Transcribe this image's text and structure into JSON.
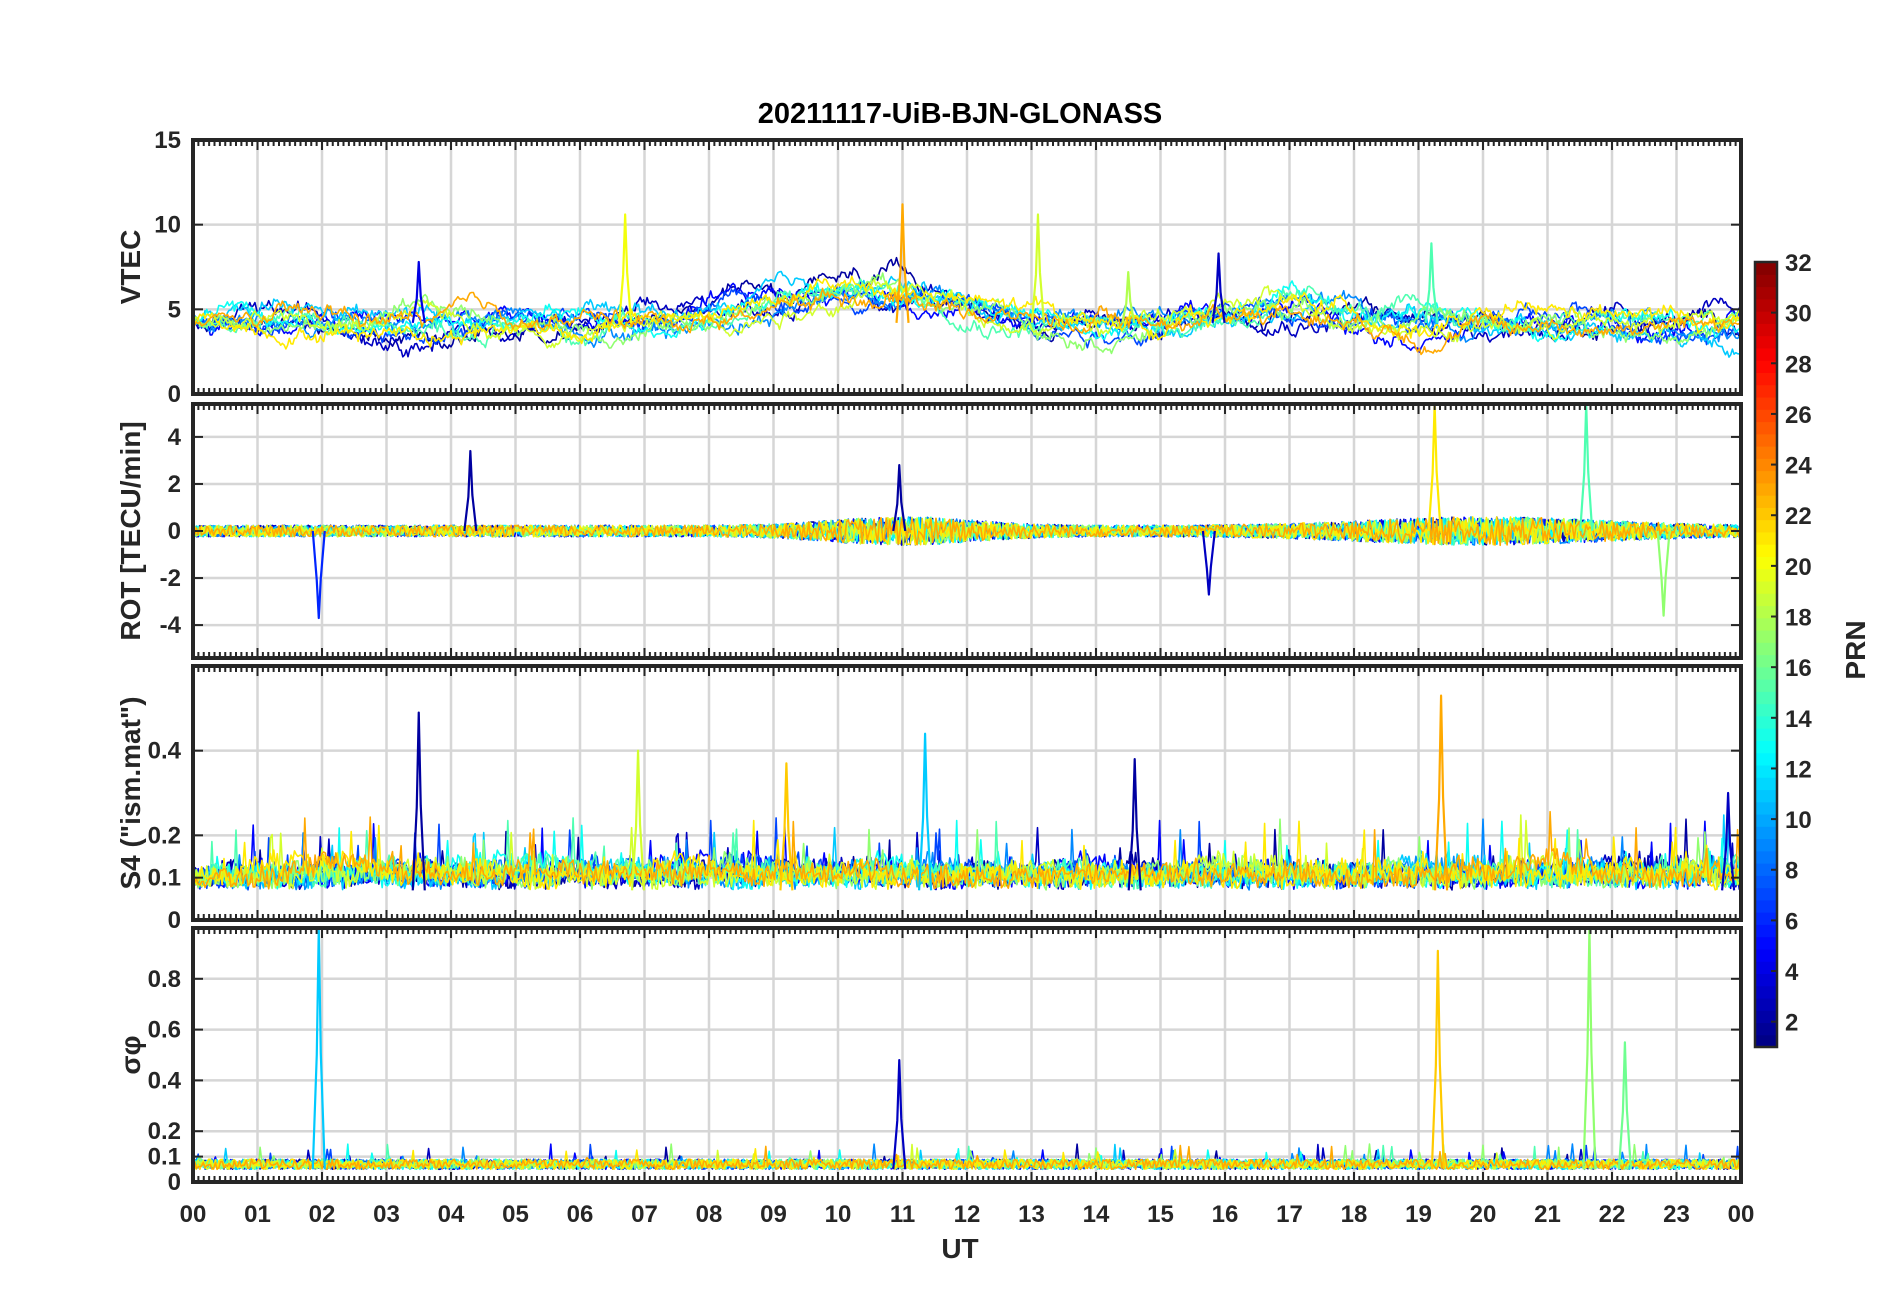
{
  "chart_data": {
    "type": "line",
    "title": "20211117-UiB-BJN-GLONASS",
    "xlabel": "UT",
    "x_tick_labels": [
      "00",
      "01",
      "02",
      "03",
      "04",
      "05",
      "06",
      "07",
      "08",
      "09",
      "10",
      "11",
      "12",
      "13",
      "14",
      "15",
      "16",
      "17",
      "18",
      "19",
      "20",
      "21",
      "22",
      "23",
      "00"
    ],
    "xlim_hours": [
      0,
      24
    ],
    "grid": true,
    "colorbar": {
      "label": "PRN",
      "range": [
        1,
        32
      ],
      "ticks": [
        "2",
        "4",
        "6",
        "8",
        "10",
        "12",
        "14",
        "16",
        "18",
        "20",
        "22",
        "24",
        "26",
        "28",
        "30",
        "32"
      ],
      "colormap": "jet"
    },
    "panels": [
      {
        "id": "vtec",
        "ylabel": "VTEC",
        "ylim": [
          0,
          15
        ],
        "yticks": [
          "0",
          "5",
          "10",
          "15"
        ],
        "ytick_values": [
          0,
          5,
          10,
          15
        ],
        "grid_values": [
          5,
          10
        ],
        "baseline": 4.2,
        "noise": 1.0,
        "features": [
          {
            "hour": 11.0,
            "value": 11.2,
            "prn": 23
          },
          {
            "hour": 6.7,
            "value": 10.6,
            "prn": 20
          },
          {
            "hour": 13.1,
            "value": 10.6,
            "prn": 19
          },
          {
            "hour": 19.2,
            "value": 8.9,
            "prn": 15
          },
          {
            "hour": 15.9,
            "value": 8.3,
            "prn": 3
          },
          {
            "hour": 3.5,
            "value": 7.8,
            "prn": 4
          },
          {
            "hour": 14.5,
            "value": 7.2,
            "prn": 18
          }
        ]
      },
      {
        "id": "rot",
        "ylabel": "ROT [TECU/min]",
        "ylim": [
          -5.4,
          5.4
        ],
        "yticks": [
          "-4",
          "-2",
          "0",
          "2",
          "4"
        ],
        "ytick_values": [
          -4,
          -2,
          0,
          2,
          4
        ],
        "grid_values": [
          -4,
          -2,
          0,
          2,
          4
        ],
        "baseline": 0,
        "noise": 0.35,
        "features": [
          {
            "hour": 19.25,
            "value": 5.4,
            "prn": 21
          },
          {
            "hour": 21.6,
            "value": 5.4,
            "prn": 15
          },
          {
            "hour": 4.3,
            "value": 3.4,
            "prn": 2
          },
          {
            "hour": 1.95,
            "value": -3.7,
            "prn": 6
          },
          {
            "hour": 15.75,
            "value": -2.7,
            "prn": 3
          },
          {
            "hour": 22.8,
            "value": -3.6,
            "prn": 17
          },
          {
            "hour": 10.95,
            "value": 2.8,
            "prn": 2
          }
        ]
      },
      {
        "id": "s4",
        "ylabel": "S4 (\"ism.mat\")",
        "ylim": [
          0,
          0.6
        ],
        "yticks": [
          "0",
          "0.1",
          "0.2",
          "0.4"
        ],
        "ytick_values": [
          0,
          0.1,
          0.2,
          0.4
        ],
        "grid_values": [
          0.1,
          0.2,
          0.4
        ],
        "baseline": 0.07,
        "noise": 0.05,
        "features": [
          {
            "hour": 19.35,
            "value": 0.53,
            "prn": 23
          },
          {
            "hour": 3.5,
            "value": 0.49,
            "prn": 2
          },
          {
            "hour": 11.35,
            "value": 0.44,
            "prn": 11
          },
          {
            "hour": 6.9,
            "value": 0.4,
            "prn": 19
          },
          {
            "hour": 14.6,
            "value": 0.38,
            "prn": 2
          },
          {
            "hour": 9.2,
            "value": 0.37,
            "prn": 22
          },
          {
            "hour": 23.8,
            "value": 0.3,
            "prn": 3
          }
        ]
      },
      {
        "id": "sigma_phi",
        "ylabel": "σφ",
        "ylim": [
          0,
          1
        ],
        "yticks": [
          "0",
          "0.1",
          "0.2",
          "0.4",
          "0.6",
          "0.8"
        ],
        "ytick_values": [
          0,
          0.1,
          0.2,
          0.4,
          0.6,
          0.8
        ],
        "grid_values": [
          0.1,
          0.2,
          0.4,
          0.6,
          0.8
        ],
        "baseline": 0.05,
        "noise": 0.04,
        "features": [
          {
            "hour": 1.95,
            "value": 1.0,
            "prn": 11
          },
          {
            "hour": 21.65,
            "value": 1.0,
            "prn": 17
          },
          {
            "hour": 19.3,
            "value": 0.91,
            "prn": 22
          },
          {
            "hour": 22.2,
            "value": 0.55,
            "prn": 16
          },
          {
            "hour": 10.95,
            "value": 0.48,
            "prn": 3
          }
        ]
      }
    ],
    "series_prns": [
      2,
      3,
      5,
      7,
      9,
      11,
      13,
      15,
      17,
      19,
      21,
      23
    ]
  }
}
